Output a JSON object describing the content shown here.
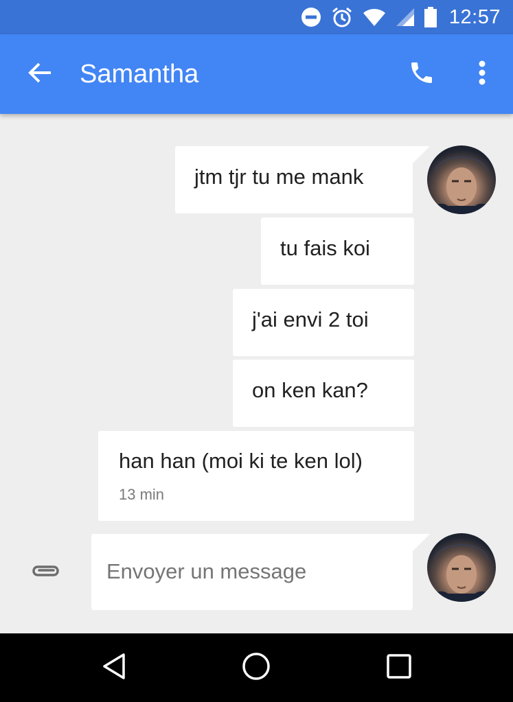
{
  "status_bar": {
    "time": "12:57",
    "icons": [
      "do-not-disturb-icon",
      "alarm-icon",
      "wifi-icon",
      "signal-icon",
      "battery-icon"
    ]
  },
  "app_bar": {
    "title": "Samantha",
    "icons": [
      "back-arrow-icon",
      "phone-icon",
      "more-vert-icon"
    ],
    "color": "#4285f4"
  },
  "messages": [
    {
      "text": "jtm tjr tu me mank"
    },
    {
      "text": "tu fais koi"
    },
    {
      "text": "j'ai envi 2 toi"
    },
    {
      "text": "on ken kan?"
    },
    {
      "text": "han han (moi ki te ken lol)",
      "time": "13 min"
    }
  ],
  "composer": {
    "placeholder": "Envoyer un message",
    "value": ""
  },
  "nav_bar": {
    "icons": [
      "back-triangle-icon",
      "home-circle-icon",
      "recents-square-icon"
    ]
  }
}
